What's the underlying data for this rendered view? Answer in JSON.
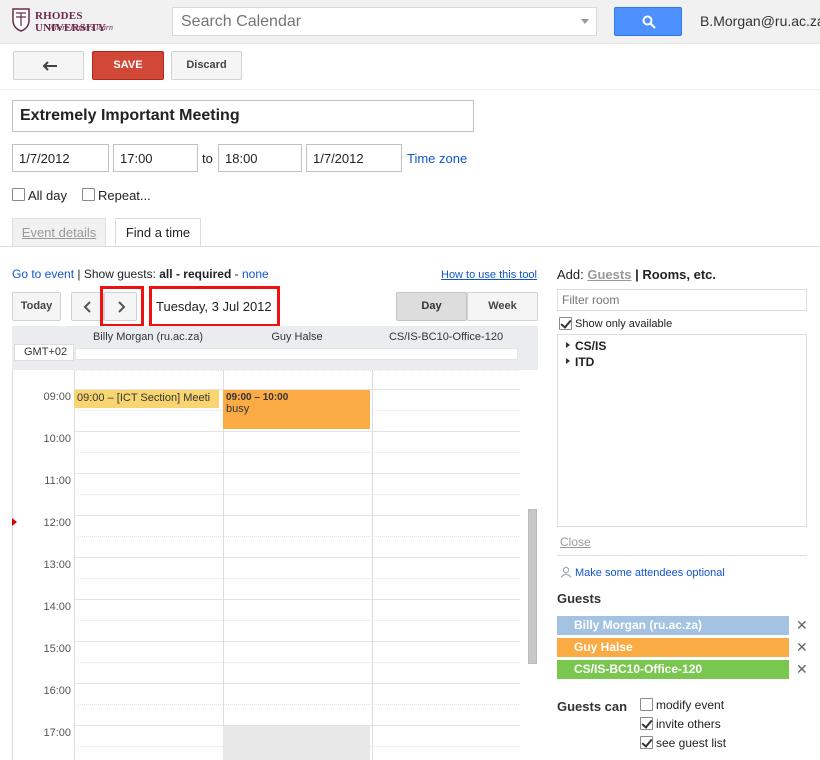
{
  "header": {
    "logo": {
      "university": "RHODES UNIVERSITY",
      "motto": "Where leaders learn",
      "brand_color": "#6b2a4c"
    },
    "search": {
      "placeholder": "Search Calendar"
    },
    "user_email": "B.Morgan@ru.ac.za"
  },
  "toolbar": {
    "back_icon": "back-arrow-icon",
    "save_label": "SAVE",
    "discard_label": "Discard"
  },
  "event": {
    "title": "Extremely Important Meeting",
    "start_date": "1/7/2012",
    "start_time": "17:00",
    "to_label": "to",
    "end_time": "18:00",
    "end_date": "1/7/2012",
    "timezone_label": "Time zone",
    "all_day_label": "All day",
    "all_day_checked": false,
    "repeat_label": "Repeat...",
    "repeat_checked": false
  },
  "tabs": [
    {
      "label": "Event details",
      "active": false
    },
    {
      "label": "Find a time",
      "active": true
    }
  ],
  "guest_filter": {
    "go_to_event": "Go to event",
    "separator": "|",
    "show_guests": "Show guests:",
    "all": "all",
    "dash": "-",
    "required": "required",
    "none": "none",
    "how_to": "How to use this tool"
  },
  "nav": {
    "today_label": "Today",
    "date_display": "Tuesday, 3 Jul 2012",
    "day_label": "Day",
    "week_label": "Week",
    "view_selected": "Day"
  },
  "grid": {
    "timezone": "GMT+02",
    "columns": [
      "Billy Morgan (ru.ac.za)",
      "Guy Halse",
      "CS/IS-BC10-Office-120"
    ],
    "hours": [
      "09:00",
      "10:00",
      "11:00",
      "12:00",
      "13:00",
      "14:00",
      "15:00",
      "16:00",
      "17:00"
    ],
    "events": [
      {
        "column": "Billy Morgan (ru.ac.za)",
        "time": "09:00 – [ICT Section] Meeti",
        "color": "#f9d572"
      },
      {
        "column": "Guy Halse",
        "time": "09:00 – 10:00",
        "status": "busy",
        "color": "#fbab43"
      }
    ]
  },
  "right_panel": {
    "add_label": "Add:",
    "guests_label": "Guests",
    "divider": "|",
    "rooms_label": "Rooms, etc.",
    "filter_placeholder": "Filter room",
    "only_available_label": "Show only available",
    "only_available_checked": true,
    "rooms": [
      "CS/IS",
      "ITD"
    ],
    "close_label": "Close",
    "optional_label": "Make some attendees optional",
    "guests_heading": "Guests",
    "guests": [
      {
        "name": "Billy Morgan (ru.ac.za)",
        "color": "#a4c2e2"
      },
      {
        "name": "Guy Halse",
        "color": "#fbab43"
      },
      {
        "name": "CS/IS-BC10-Office-120",
        "color": "#7ac74f"
      }
    ],
    "remove_symbol": "✕",
    "guests_can_label": "Guests can",
    "permissions": [
      {
        "label": "modify event",
        "checked": false
      },
      {
        "label": "invite others",
        "checked": true
      },
      {
        "label": "see guest list",
        "checked": true
      }
    ]
  }
}
